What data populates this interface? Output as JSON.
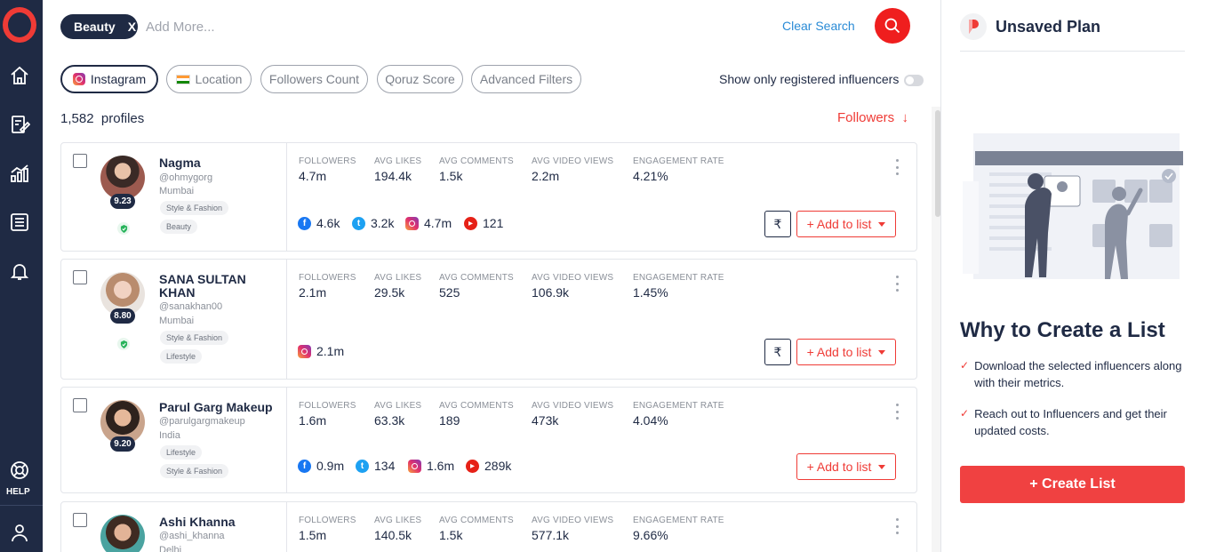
{
  "search": {
    "chip": "Beauty",
    "chip_remove": "X",
    "placeholder": "Add More...",
    "clear": "Clear Search"
  },
  "filters": [
    {
      "label": "Instagram"
    },
    {
      "label": "Location"
    },
    {
      "label": "Followers Count"
    },
    {
      "label": "Qoruz Score"
    },
    {
      "label": "Advanced Filters"
    }
  ],
  "registered_toggle": {
    "label": "Show only registered influencers",
    "on": false
  },
  "results": {
    "count": "1,582",
    "unit": "profiles",
    "sort_label": "Followers",
    "sort_arrow": "↓"
  },
  "metric_labels": [
    "FOLLOWERS",
    "AVG LIKES",
    "AVG COMMENTS",
    "AVG VIDEO VIEWS",
    "ENGAGEMENT RATE"
  ],
  "add_label": "+ Add to list",
  "rupee": "₹",
  "profiles": [
    {
      "name": "Nagma",
      "handle": "@ohmygorg",
      "city": "Mumbai",
      "score": "9.23",
      "tags": [
        "Style & Fashion",
        "Beauty"
      ],
      "metrics": [
        "4.7m",
        "194.4k",
        "1.5k",
        "2.2m",
        "4.21%"
      ],
      "social": {
        "facebook": "4.6k",
        "twitter": "3.2k",
        "instagram": "4.7m",
        "youtube": "121"
      }
    },
    {
      "name": "SANA SULTAN KHAN",
      "handle": "@sanakhan00",
      "city": "Mumbai",
      "score": "8.80",
      "tags": [
        "Style & Fashion",
        "Lifestyle"
      ],
      "metrics": [
        "2.1m",
        "29.5k",
        "525",
        "106.9k",
        "1.45%"
      ],
      "social": {
        "instagram": "2.1m"
      }
    },
    {
      "name": "Parul Garg Makeup",
      "handle": "@parulgargmakeup",
      "city": "India",
      "score": "9.20",
      "tags": [
        "Lifestyle",
        "Style & Fashion"
      ],
      "metrics": [
        "1.6m",
        "63.3k",
        "189",
        "473k",
        "4.04%"
      ],
      "social": {
        "facebook": "0.9m",
        "twitter": "134",
        "instagram": "1.6m",
        "youtube": "289k"
      }
    },
    {
      "name": "Ashi Khanna",
      "handle": "@ashi_khanna",
      "city": "Delhi",
      "metrics": [
        "1.5m",
        "140.5k",
        "1.5k",
        "577.1k",
        "9.66%"
      ]
    }
  ],
  "nav": {
    "help": "HELP"
  },
  "panel": {
    "title": "Unsaved Plan",
    "why_title": "Why to Create a List",
    "points": [
      "Download the selected influencers along with their metrics.",
      "Reach out to Influencers and get their updated costs."
    ],
    "check_glyph": "✓",
    "create_button": "+ Create List"
  },
  "colors": {
    "accent": "#ef3b36",
    "navy": "#1f2a44",
    "link": "#2a8bd6"
  }
}
